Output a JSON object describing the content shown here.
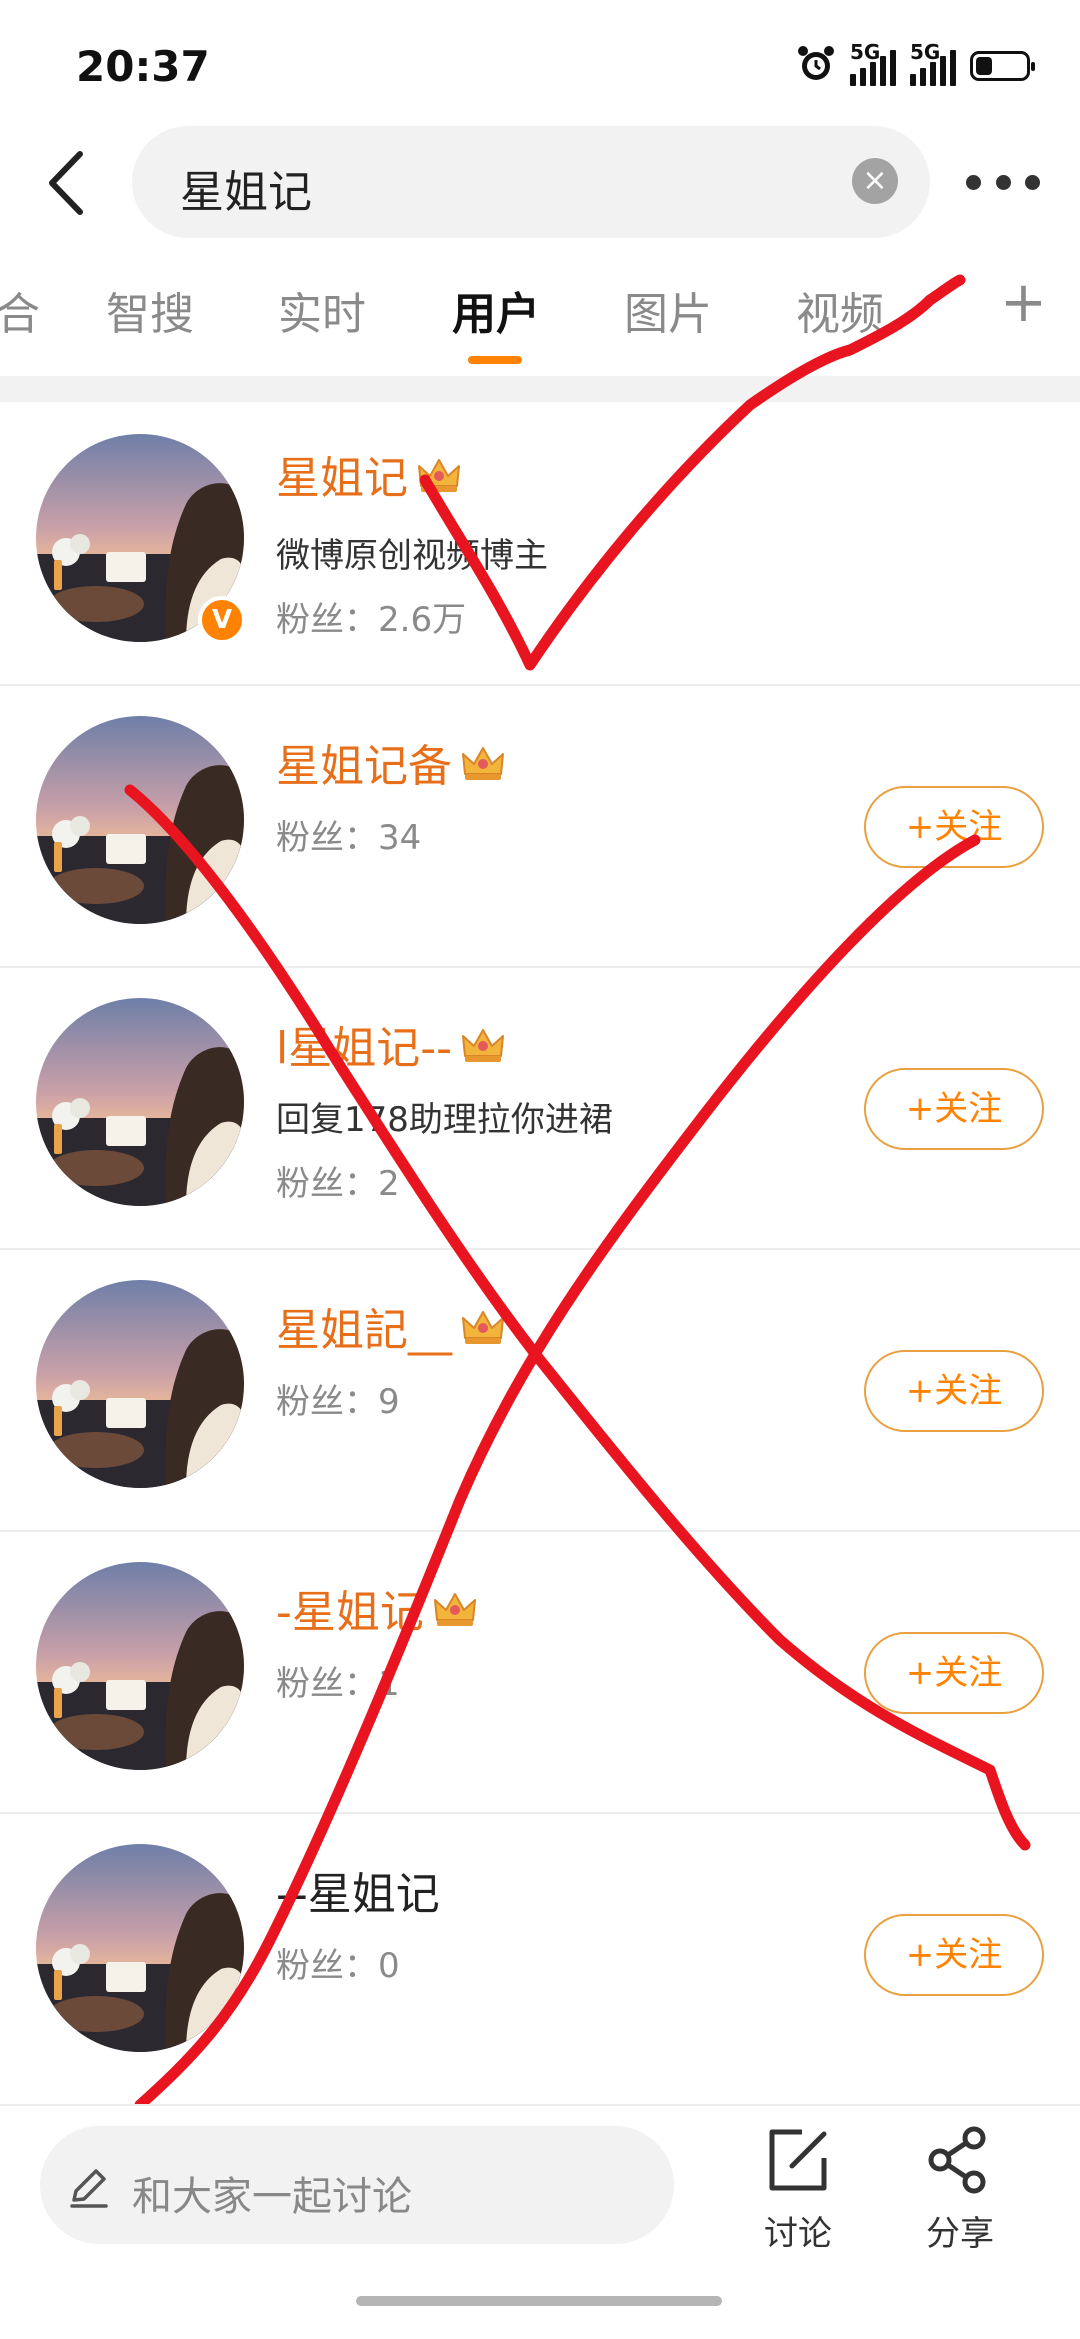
{
  "status_bar": {
    "time": "20:37",
    "signal_labels": [
      "5G",
      "5G"
    ],
    "battery_level": 0.3
  },
  "search": {
    "query": "星姐记"
  },
  "tabs": [
    {
      "label": "综合",
      "display": "合"
    },
    {
      "label": "智搜"
    },
    {
      "label": "实时"
    },
    {
      "label": "用户",
      "active": true
    },
    {
      "label": "图片"
    },
    {
      "label": "视频"
    }
  ],
  "users": [
    {
      "name": "星姐记",
      "crown": true,
      "verified": true,
      "description": "微博原创视频博主",
      "fans_label": "粉丝：",
      "fans": "2.6万",
      "follow_label": ""
    },
    {
      "name": "星姐记备",
      "crown": true,
      "fans_label": "粉丝：",
      "fans": "34",
      "follow_label": "+关注"
    },
    {
      "name": "l星姐记--",
      "crown": true,
      "description": "回复178助理拉你进裙",
      "fans_label": "粉丝：",
      "fans": "2",
      "follow_label": "+关注"
    },
    {
      "name": "星姐記__",
      "crown": true,
      "fans_label": "粉丝：",
      "fans": "9",
      "follow_label": "+关注"
    },
    {
      "name": "-星姐记",
      "crown": true,
      "fans_label": "粉丝：",
      "fans": "1",
      "follow_label": "+关注"
    },
    {
      "name": "--星姐记",
      "crown": false,
      "fans_label": "粉丝：",
      "fans": "0",
      "follow_label": "+关注"
    }
  ],
  "bottom_bar": {
    "input_placeholder": "和大家一起讨论",
    "discuss_label": "讨论",
    "share_label": "分享"
  },
  "colors": {
    "accent": "#ff8200",
    "username": "#e86f1a",
    "annotation": "#e8141f"
  }
}
